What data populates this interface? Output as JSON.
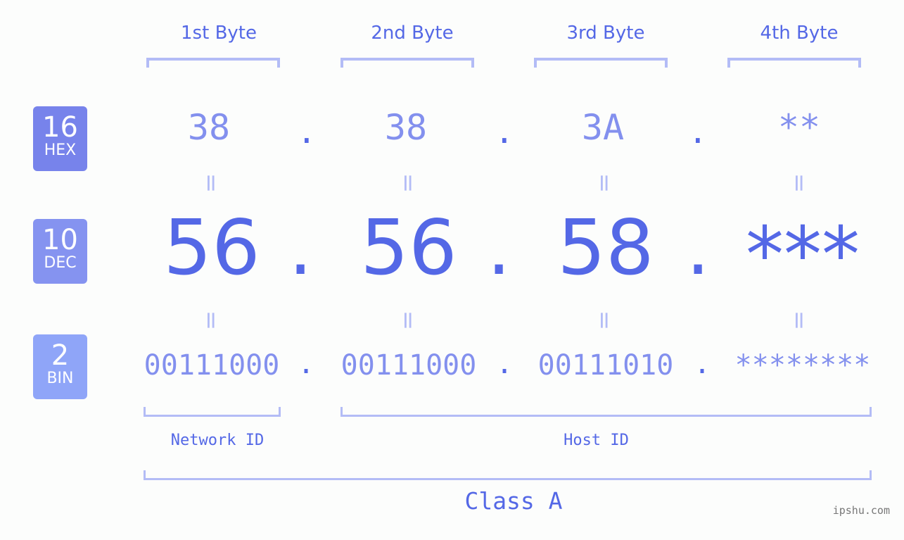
{
  "headers": [
    "1st Byte",
    "2nd Byte",
    "3rd Byte",
    "4th Byte"
  ],
  "badges": [
    {
      "num": "16",
      "label": "HEX",
      "color": "#7783eb"
    },
    {
      "num": "10",
      "label": "DEC",
      "color": "#8593f0"
    },
    {
      "num": "2",
      "label": "BIN",
      "color": "#8fa5f8"
    }
  ],
  "hex": [
    "38",
    "38",
    "3A",
    "**"
  ],
  "dec": [
    "56",
    "56",
    "58",
    "***"
  ],
  "bin": [
    "00111000",
    "00111000",
    "00111010",
    "********"
  ],
  "separator": ".",
  "equals": "=",
  "parts": {
    "network": "Network ID",
    "host": "Host ID"
  },
  "class_label": "Class A",
  "watermark": "ipshu.com",
  "colors": {
    "primary": "#5468e6",
    "secondary": "#8390ee",
    "bracket": "#b3bcf6"
  }
}
